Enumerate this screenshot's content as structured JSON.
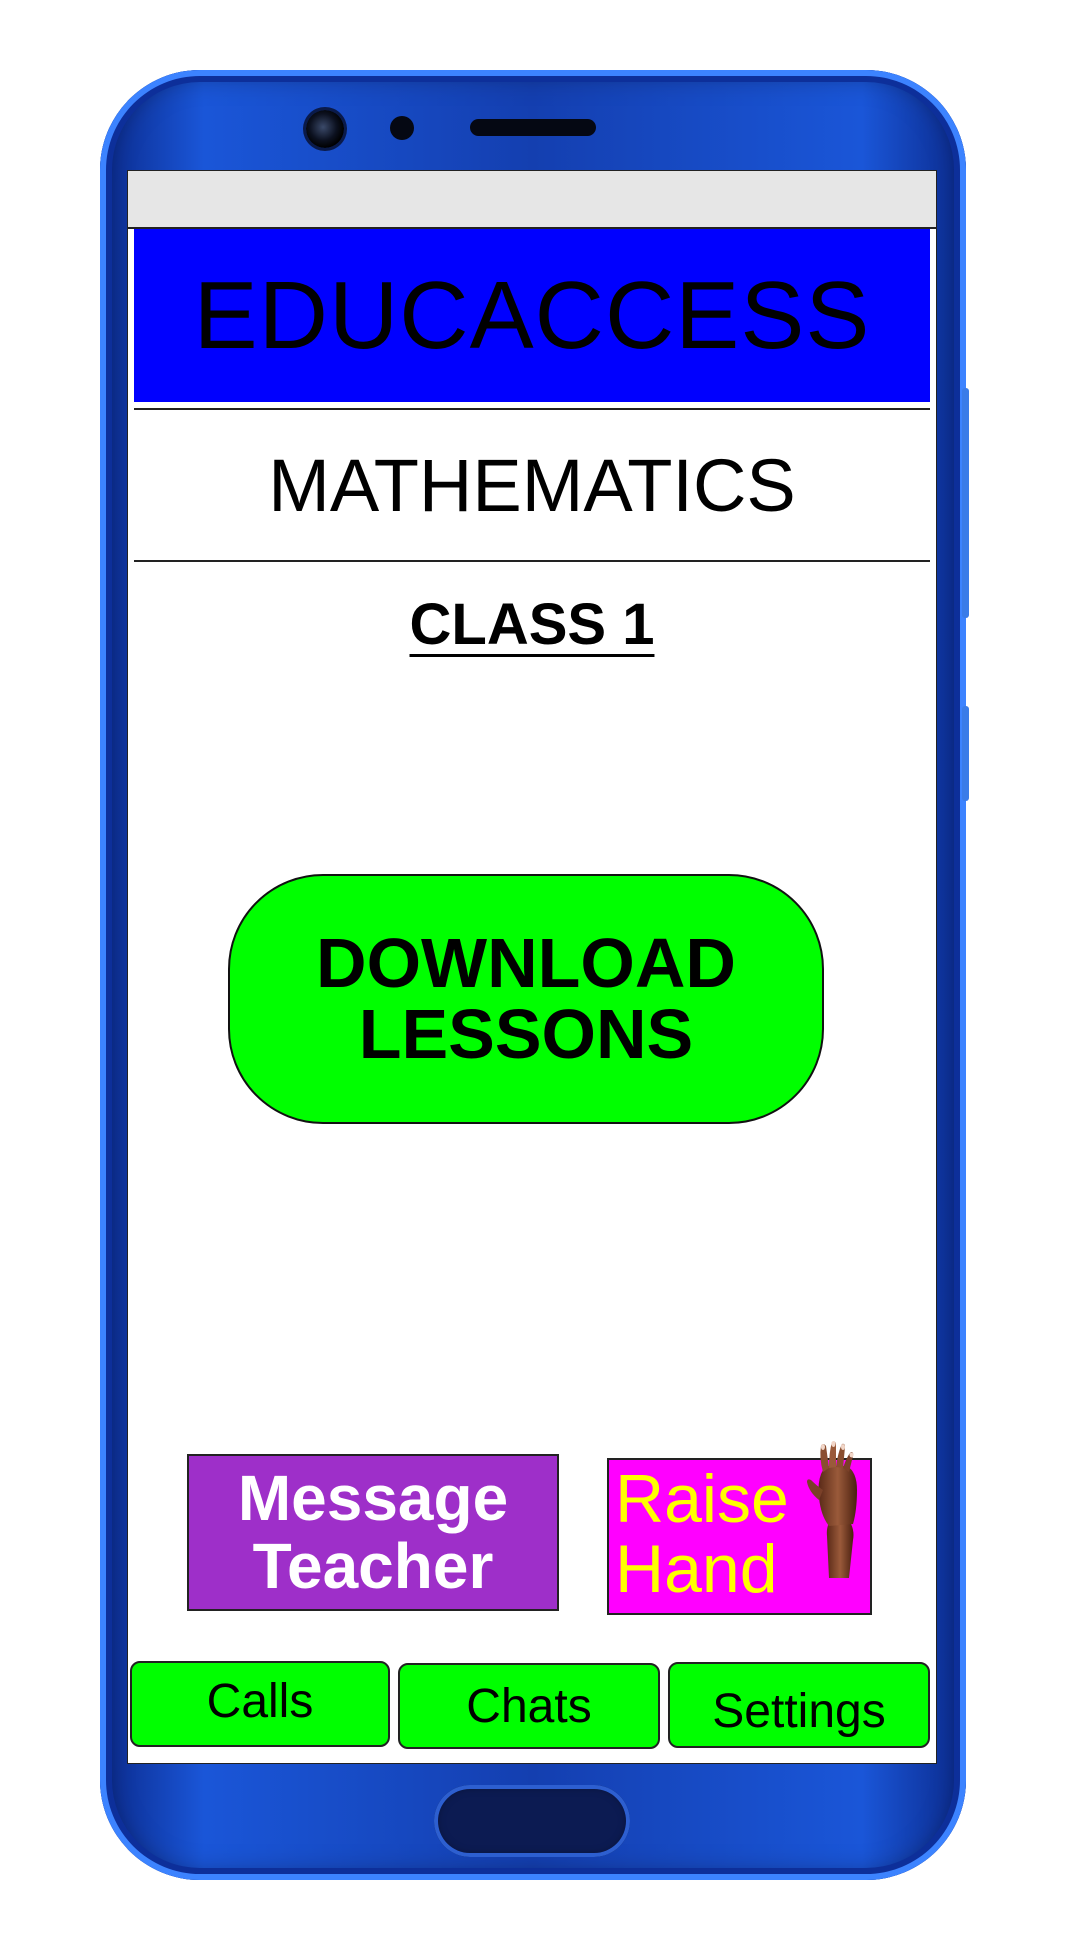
{
  "app": {
    "title": "EDUCACCESS"
  },
  "subject": {
    "title": "MATHEMATICS",
    "class_label": "CLASS 1"
  },
  "download": {
    "line1": "DOWNLOAD",
    "line2": "LESSONS"
  },
  "actions": {
    "message_line1": "Message",
    "message_line2": "Teacher",
    "raise_line1": "Raise",
    "raise_line2": "Hand"
  },
  "nav": {
    "calls": "Calls",
    "chats": "Chats",
    "settings": "Settings"
  },
  "colors": {
    "header_bg": "#0000ff",
    "button_green": "#00ff00",
    "message_purple": "#9e2fc9",
    "raise_magenta": "#ff00ff",
    "raise_text_yellow": "#ffff00",
    "phone_blue": "#143fb0"
  },
  "icons": {
    "raise_hand": "raised-hand-icon"
  }
}
